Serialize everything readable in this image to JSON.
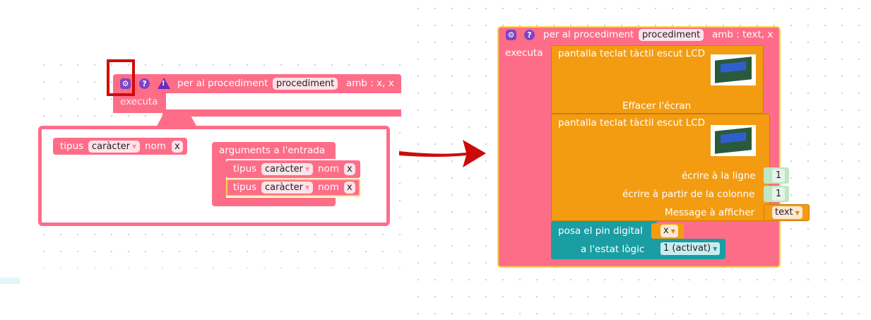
{
  "left": {
    "header": {
      "prefix": "per al procediment",
      "name": "procediment",
      "suffix": "amb : x, x",
      "body_label": "executa"
    },
    "mutator": {
      "param_block": {
        "label": "tipus",
        "type": "caràcter",
        "nom": "nom",
        "var": "x"
      },
      "container_label": "arguments a l'entrada",
      "items": [
        {
          "label": "tipus",
          "type": "caràcter",
          "nom": "nom",
          "var": "x"
        },
        {
          "label": "tipus",
          "type": "caràcter",
          "nom": "nom",
          "var": "x"
        }
      ]
    }
  },
  "right": {
    "header": {
      "prefix": "per al procediment",
      "name": "procediment",
      "suffix": "amb : text, x",
      "body_label": "executa"
    },
    "lcd1": {
      "title": "pantalla teclat tàctil escut LCD",
      "action": "Effacer l'écran"
    },
    "lcd2": {
      "title": "pantalla teclat tàctil escut LCD",
      "row_label": "écrire à la ligne",
      "row_value": "1",
      "col_label": "écrire à partir de la colonne",
      "col_value": "1",
      "msg_label": "Message à afficher",
      "msg_value": "text"
    },
    "pin": {
      "label": "posa el pin digital",
      "pin_var": "x",
      "state_label": "a l'estat lògic",
      "state_value": "1 (activat)"
    }
  },
  "colors": {
    "procedure": "#fe6d88",
    "lcd": "#f39c12",
    "pin": "#1a9ea3",
    "highlight": "#d20a0a"
  },
  "icons": [
    "gear-icon",
    "help-icon",
    "warning-icon",
    "arrow-icon",
    "lcd-image"
  ]
}
